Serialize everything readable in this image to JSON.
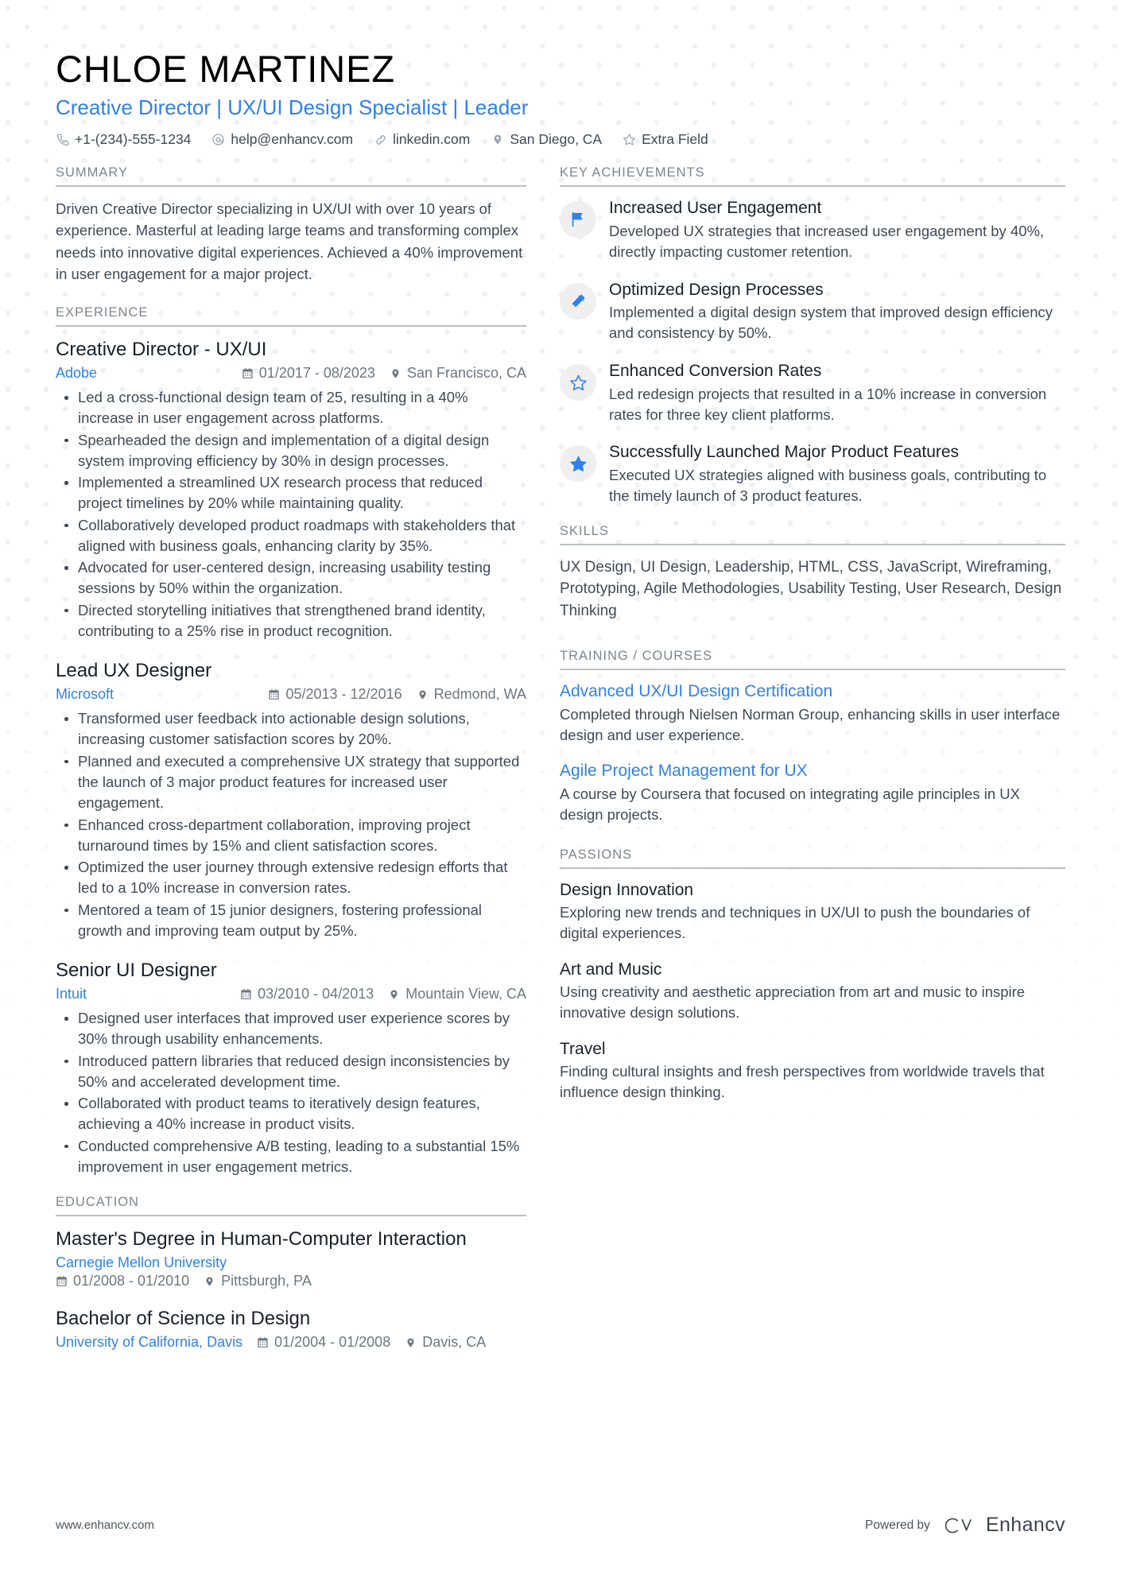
{
  "header": {
    "name": "CHLOE MARTINEZ",
    "headline": "Creative Director | UX/UI Design Specialist | Leader",
    "contacts": [
      {
        "icon": "phone-icon",
        "value": "+1-(234)-555-1234"
      },
      {
        "icon": "email-icon",
        "value": "help@enhancv.com"
      },
      {
        "icon": "link-icon",
        "value": "linkedin.com"
      },
      {
        "icon": "location-icon",
        "value": "San Diego, CA"
      },
      {
        "icon": "star-outline-icon",
        "value": "Extra Field"
      }
    ]
  },
  "summary": {
    "title": "SUMMARY",
    "text": "Driven Creative Director specializing in UX/UI with over 10 years of experience. Masterful at leading large teams and transforming complex needs into innovative digital experiences. Achieved a 40% improvement in user engagement for a major project."
  },
  "experience": {
    "title": "EXPERIENCE",
    "entries": [
      {
        "role": "Creative Director - UX/UI",
        "company": "Adobe",
        "dates": "01/2017 - 08/2023",
        "location": "San Francisco, CA",
        "bullets": [
          "Led a cross-functional design team of 25, resulting in a 40% increase in user engagement across platforms.",
          "Spearheaded the design and implementation of a digital design system improving efficiency by 30% in design processes.",
          "Implemented a streamlined UX research process that reduced project timelines by 20% while maintaining quality.",
          "Collaboratively developed product roadmaps with stakeholders that aligned with business goals, enhancing clarity by 35%.",
          "Advocated for user-centered design, increasing usability testing sessions by 50% within the organization.",
          "Directed storytelling initiatives that strengthened brand identity, contributing to a 25% rise in product recognition."
        ]
      },
      {
        "role": "Lead UX Designer",
        "company": "Microsoft",
        "dates": "05/2013 - 12/2016",
        "location": "Redmond, WA",
        "bullets": [
          "Transformed user feedback into actionable design solutions, increasing customer satisfaction scores by 20%.",
          "Planned and executed a comprehensive UX strategy that supported the launch of 3 major product features for increased user engagement.",
          "Enhanced cross-department collaboration, improving project turnaround times by 15% and client satisfaction scores.",
          "Optimized the user journey through extensive redesign efforts that led to a 10% increase in conversion rates.",
          "Mentored a team of 15 junior designers, fostering professional growth and improving team output by 25%."
        ]
      },
      {
        "role": "Senior UI Designer",
        "company": "Intuit",
        "dates": "03/2010 - 04/2013",
        "location": "Mountain View, CA",
        "bullets": [
          "Designed user interfaces that improved user experience scores by 30% through usability enhancements.",
          "Introduced pattern libraries that reduced design inconsistencies by 50% and accelerated development time.",
          "Collaborated with product teams to iteratively design features, achieving a 40% increase in product visits.",
          "Conducted comprehensive A/B testing, leading to a substantial 15% improvement in user engagement metrics."
        ]
      }
    ]
  },
  "education": {
    "title": "EDUCATION",
    "entries": [
      {
        "degree": "Master's Degree in Human-Computer Interaction",
        "school": "Carnegie Mellon University",
        "dates": "01/2008 - 01/2010",
        "location": "Pittsburgh, PA"
      },
      {
        "degree": "Bachelor of Science in Design",
        "school": "University of California, Davis",
        "dates": "01/2004 - 01/2008",
        "location": "Davis, CA"
      }
    ]
  },
  "achievements": {
    "title": "KEY ACHIEVEMENTS",
    "items": [
      {
        "icon": "flag-icon",
        "title": "Increased User Engagement",
        "desc": "Developed UX strategies that increased user engagement by 40%, directly impacting customer retention."
      },
      {
        "icon": "magic-wand-icon",
        "title": "Optimized Design Processes",
        "desc": "Implemented a digital design system that improved design efficiency and consistency by 50%."
      },
      {
        "icon": "star-outline-icon",
        "title": "Enhanced Conversion Rates",
        "desc": "Led redesign projects that resulted in a 10% increase in conversion rates for three key client platforms."
      },
      {
        "icon": "star-filled-icon",
        "title": "Successfully Launched Major Product Features",
        "desc": "Executed UX strategies aligned with business goals, contributing to the timely launch of 3 product features."
      }
    ]
  },
  "skills": {
    "title": "SKILLS",
    "text": "UX Design, UI Design, Leadership, HTML, CSS, JavaScript, Wireframing, Prototyping, Agile Methodologies, Usability Testing, User Research, Design Thinking"
  },
  "training": {
    "title": "TRAINING / COURSES",
    "items": [
      {
        "name": "Advanced UX/UI Design Certification",
        "desc": "Completed through Nielsen Norman Group, enhancing skills in user interface design and user experience."
      },
      {
        "name": "Agile Project Management for UX",
        "desc": "A course by Coursera that focused on integrating agile principles in UX design projects."
      }
    ]
  },
  "passions": {
    "title": "PASSIONS",
    "items": [
      {
        "name": "Design Innovation",
        "desc": "Exploring new trends and techniques in UX/UI to push the boundaries of digital experiences."
      },
      {
        "name": "Art and Music",
        "desc": "Using creativity and aesthetic appreciation from art and music to inspire innovative design solutions."
      },
      {
        "name": "Travel",
        "desc": "Finding cultural insights and fresh perspectives from worldwide travels that influence design thinking."
      }
    ]
  },
  "footer": {
    "url": "www.enhancv.com",
    "powered_by": "Powered by",
    "brand": "Enhancv"
  },
  "colors": {
    "accent": "#2f80ed",
    "text": "#3f4a57",
    "heading": "#17212b",
    "muted": "#7b858f",
    "rule": "#b9bfc5",
    "badge_bg": "#efefef"
  }
}
